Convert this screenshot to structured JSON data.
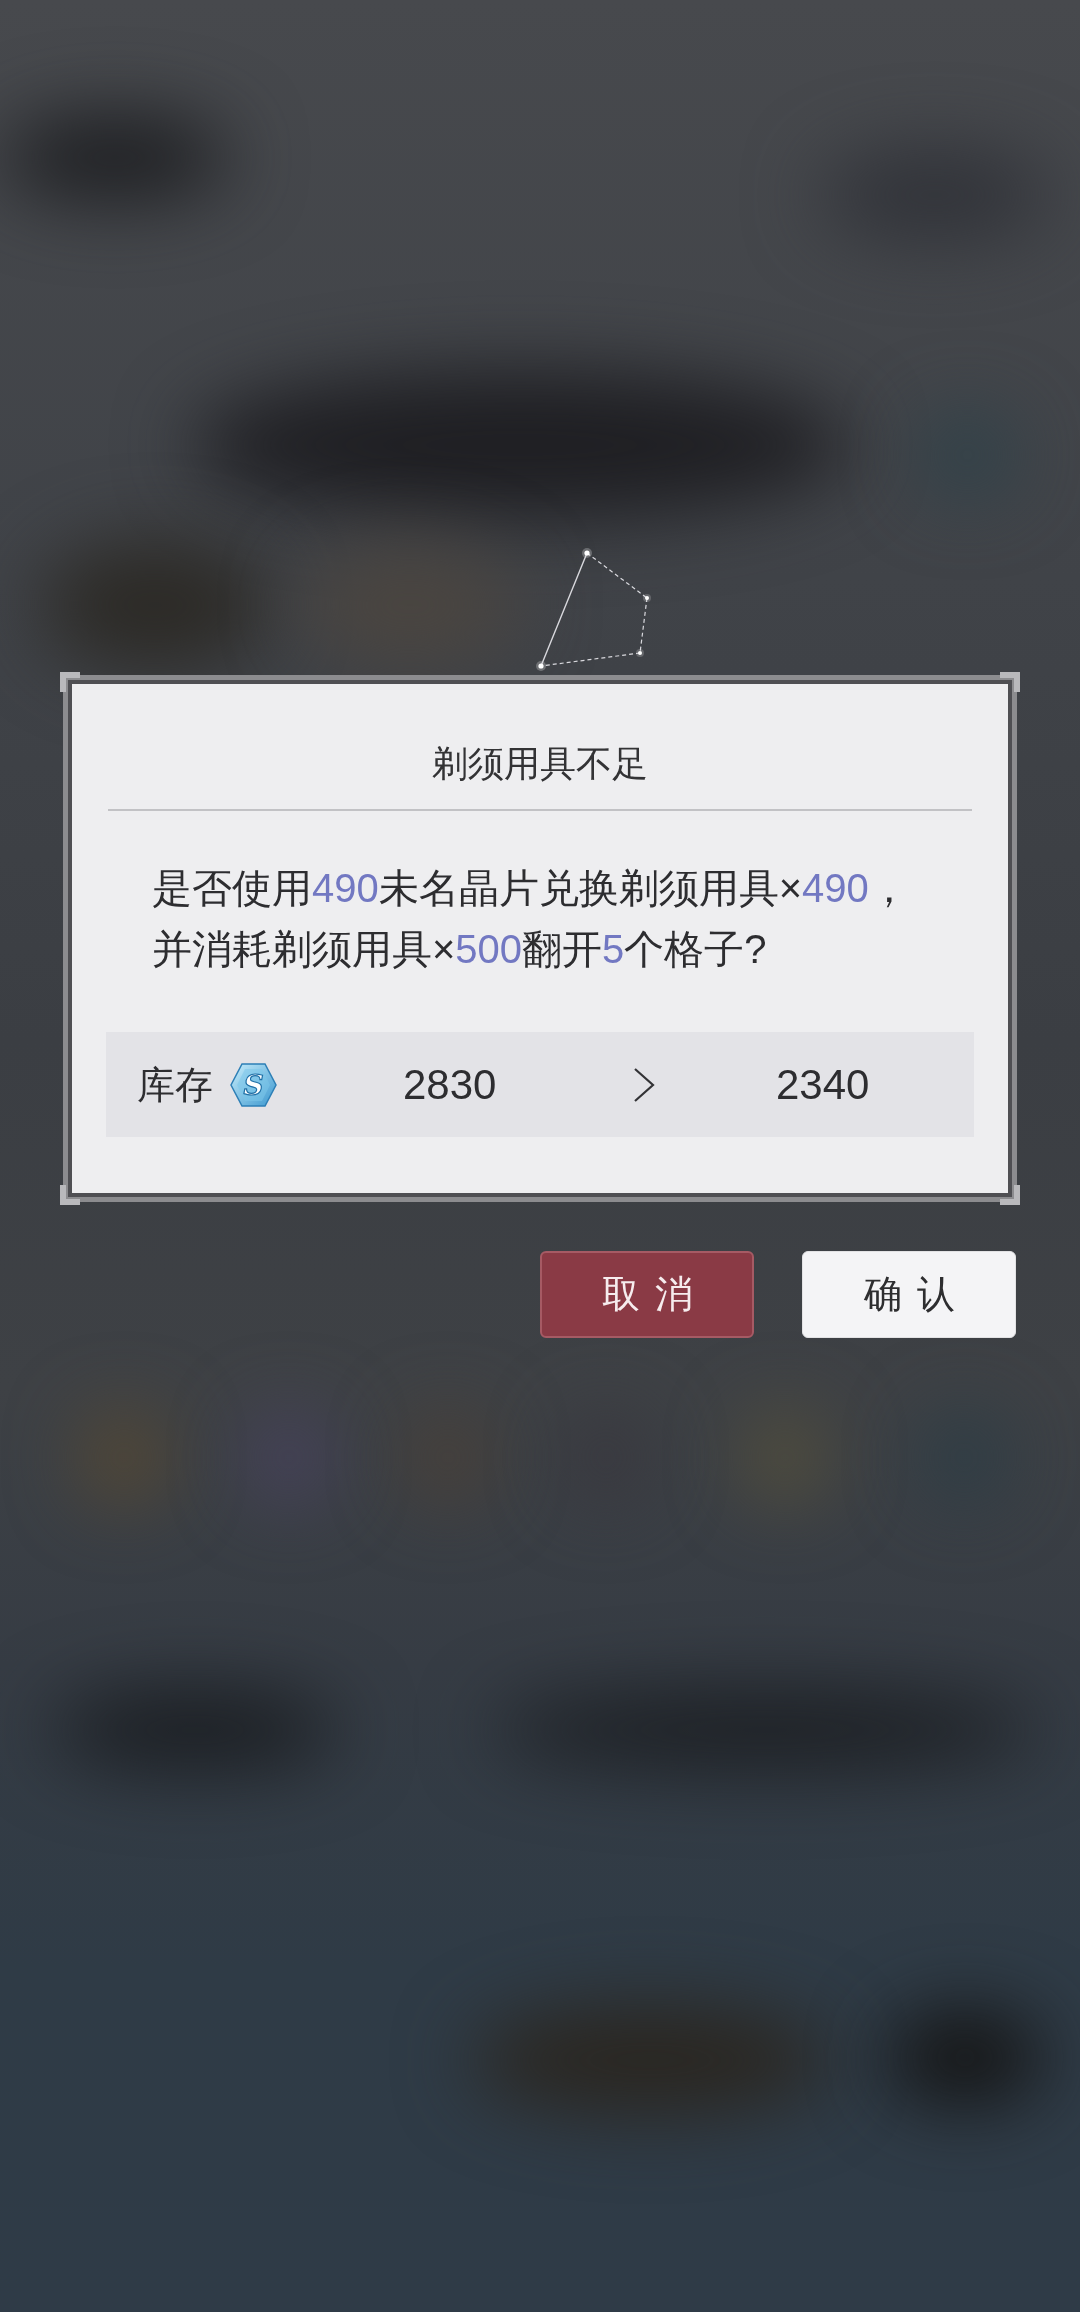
{
  "dialog": {
    "title": "剃须用具不足",
    "message": [
      {
        "text": "是否使用",
        "highlight": false
      },
      {
        "text": "490",
        "highlight": true
      },
      {
        "text": "未名晶片兑换剃须用具×",
        "highlight": false
      },
      {
        "text": "490",
        "highlight": true
      },
      {
        "text": "，并消耗剃须用具×",
        "highlight": false
      },
      {
        "text": "500",
        "highlight": true
      },
      {
        "text": "翻开",
        "highlight": false
      },
      {
        "text": "5",
        "highlight": true
      },
      {
        "text": "个格子?",
        "highlight": false
      }
    ],
    "inventory": {
      "label": "库存",
      "icon_text": "S",
      "current": "2830",
      "after": "2340"
    }
  },
  "buttons": [
    {
      "label": "取消",
      "kind": "cancel"
    },
    {
      "label": "确认",
      "kind": "confirm"
    }
  ]
}
